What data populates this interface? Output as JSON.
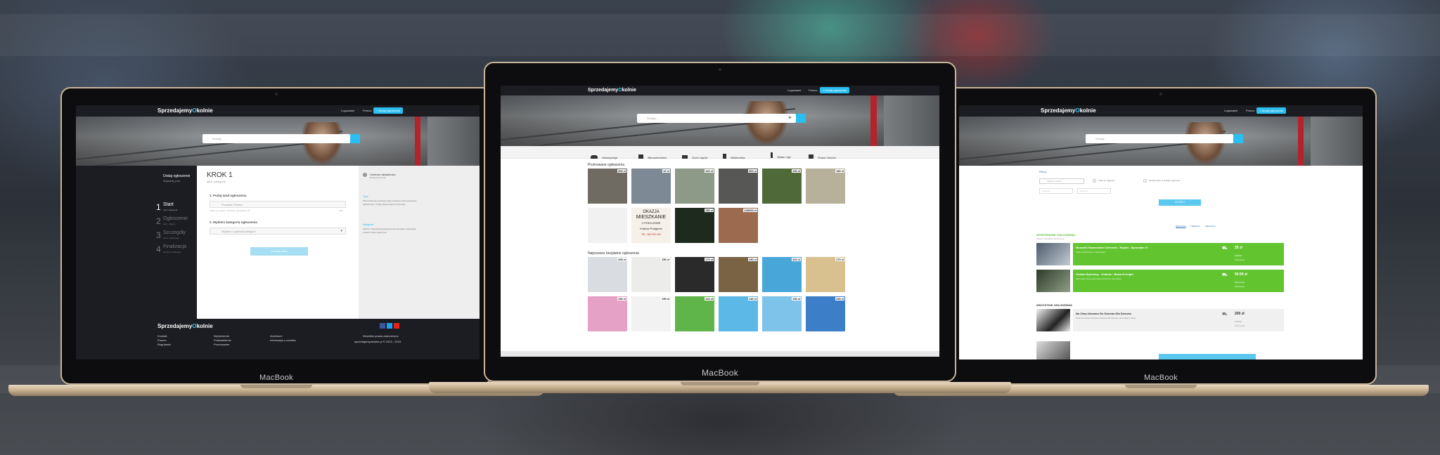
{
  "site": {
    "logo_left": "Sprzedajemy",
    "logo_o": "O",
    "logo_right": "kolnie",
    "nav_login": "Logowanie",
    "nav_help": "Pomoc",
    "add_button": "+ Dodaj ogłoszenie",
    "search_placeholder": "Szukaj..."
  },
  "laptop_brand": "MacBook",
  "left_screen": {
    "sidebar_title": "Dodaj ogłoszenie",
    "sidebar_sub": "Wypełnij pola",
    "steps": [
      {
        "num": "1",
        "label": "Start",
        "sub": "tytuł i kategoria"
      },
      {
        "num": "2",
        "label": "Ogłoszenie",
        "sub": "opis i zdjęcia"
      },
      {
        "num": "3",
        "label": "Szczegóły",
        "sub": "cena i lokalizacja"
      },
      {
        "num": "4",
        "label": "Finalizacja",
        "sub": "kontakt i publikacja"
      }
    ],
    "step_heading": "KROK 1",
    "step_sub": "tytuł i kategoria",
    "field1_label": "1. Podaj tytuł ogłoszenia",
    "field1_value": "Przykład: Rower...",
    "field1_hint": "Wpisz np. Rower, Telewizor, Mieszkanie itd.",
    "field1_count": "0/60",
    "field2_label": "2. Wybierz kategorię ogłoszenia",
    "field2_value": "Wybierz z głównej kategorii",
    "next_button": "Przejdź dalej",
    "help_title": "Centrum aktualności",
    "help_sub": "Dodaj ogłoszenie",
    "help_heading1": "Tytuł",
    "help_text1": "Wprowadzenie krótkiego tytułu zwiększa zainteresowanie ogłoszeniem. Podaj najważniejsze informacje.",
    "help_heading2": "Kategoria",
    "help_text2": "Wybierz odpowiednią kategorię aby kupujący mogli łatwo znaleźć Twoje ogłoszenie.",
    "footer_cols": [
      [
        "Kontakt",
        "Pomoc",
        "Regulamin"
      ],
      [
        "Wyróżnienie",
        "Podświetlenie",
        "Promowanie"
      ],
      [
        "Archiwum",
        "Informacja o cookies"
      ]
    ],
    "footer_rights": "Wszelkie prawa zastrzeżone",
    "footer_copy": "sprzedajemyokolnie.pl © 2013 - 2016"
  },
  "center_screen": {
    "categories": [
      "Motoryzacja",
      "Nieruchomości",
      "Dom i ogród",
      "Elektronika",
      "Moda i styl",
      "Praca i biznes"
    ],
    "promoted_title": "Promowane ogłoszenia",
    "promoted": [
      {
        "price": "500 zł",
        "color": "#6f6a62"
      },
      {
        "price": "22 zł",
        "color": "#7d8a96"
      },
      {
        "price": "340 zł",
        "color": "#8e9a88"
      },
      {
        "price": "500 zł",
        "color": "#575756"
      },
      {
        "price": "290 zł",
        "color": "#4f6a38"
      },
      {
        "price": "180 zł",
        "color": "#b7b09a"
      },
      {
        "price": "",
        "color": "#f1f1f1"
      },
      {
        "price": "",
        "color": "#f5f0e8"
      },
      {
        "price": "280 zł",
        "color": "#1e2a1e"
      },
      {
        "price": "240000 zł",
        "color": "#9c6b4f"
      }
    ],
    "flat_ad": [
      "OKAZJA",
      "MIESZKANIE",
      "2-POKOJOWE",
      "Kraków Podgórze",
      "TEL. 662 000 000"
    ],
    "latest_title": "Najnowsze bezpłatne ogłoszenia",
    "latest": [
      {
        "price": "200 zł",
        "color": "#d9dde2"
      },
      {
        "price": "150 zł",
        "color": "#ececea"
      },
      {
        "price": "170 zł",
        "color": "#2a2a2a"
      },
      {
        "price": "280 zł",
        "color": "#7a6345"
      },
      {
        "price": "320 zł",
        "color": "#49a6d8"
      },
      {
        "price": "270 zł",
        "color": "#d8c08f"
      },
      {
        "price": "250 zł",
        "color": "#e6a1c6"
      },
      {
        "price": "190 zł",
        "color": "#f2f2f2"
      },
      {
        "price": "210 zł",
        "color": "#5fb54a"
      },
      {
        "price": "230 zł",
        "color": "#5cb8e6"
      },
      {
        "price": "190 zł",
        "color": "#7ec3ea"
      },
      {
        "price": "200 zł",
        "color": "#3c7fc8"
      }
    ]
  },
  "right_screen": {
    "filter_title": "Filtruj",
    "filter_select": "Wybierz miasto",
    "filter_opt1": "Tylko ze zdjęciem",
    "filter_opt2": "Szukaj także w opisach ogłoszeń",
    "price_from": "cena od",
    "price_to": "cena do",
    "filter_button": "FILTRUJ",
    "sort_options": [
      "Najnowsze",
      "Najtańsze",
      "Najdroższe"
    ],
    "featured_title": "WYRÓŻNIONE OGŁOSZENIA",
    "featured_sub": "Zobacz wszystkie wyróżnione",
    "featured": [
      {
        "title": "Muszelki Swarovskie Clemente - Espirit - Sprzedam !!!",
        "desc": "Jeden pierścionek z kamieniami",
        "price": "25 zł",
        "city": "Kraków",
        "date": "3 dni temu"
      },
      {
        "title": "Zestaw Sportowy - Kraków - Bluza M Angel",
        "desc": "Sprzedam bluzę sportową rozmiar M, stan dobry.",
        "price": "50.50 zł",
        "city": "Warszawa",
        "date": "2 dni temu"
      }
    ],
    "all_title": "WSZYSTKIE OGŁOSZENIA",
    "all_items": [
      {
        "title": "Na Zimę Ubranko Do Dziecka Dla Dziecka",
        "desc": "Tanio sprzedam komplet ubranek dla dziecka, stan bardzo dobry.",
        "price": "200 zł",
        "city": "Kraków",
        "date": "3 dni temu"
      }
    ]
  }
}
